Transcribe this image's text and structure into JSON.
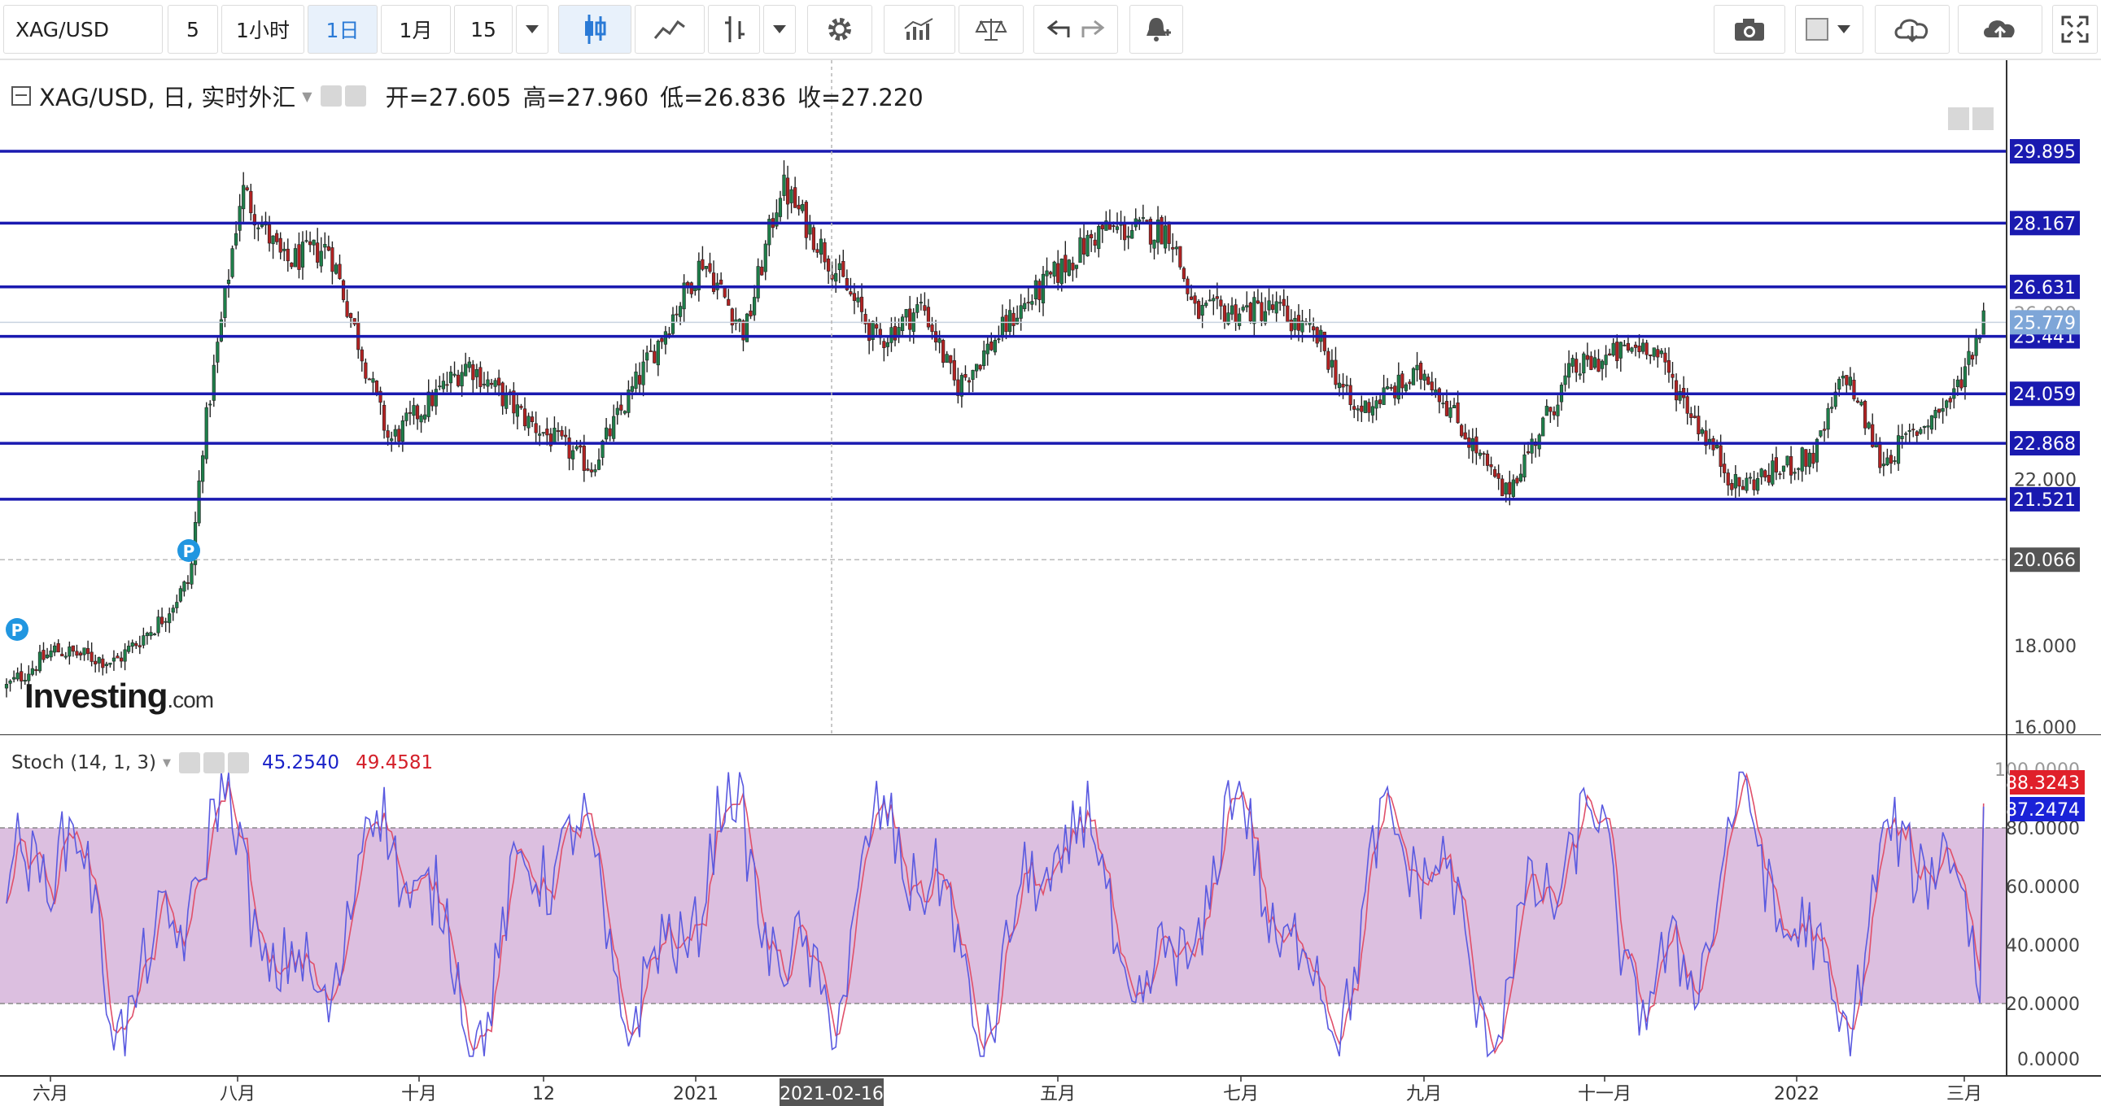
{
  "toolbar": {
    "symbol": "XAG/USD",
    "intervals": [
      "5",
      "1小时",
      "1日",
      "1月",
      "15"
    ],
    "active_interval": "1日"
  },
  "legend": {
    "title": "XAG/USD, 日, 实时外汇",
    "open": "开=27.605",
    "high": "高=27.960",
    "low": "低=26.836",
    "close": "收=27.220"
  },
  "stoch_legend": {
    "title": "Stoch (14, 1, 3)",
    "k_value": "45.2540",
    "d_value": "49.4581",
    "k_color": "#1a22c8",
    "d_color": "#d4202a"
  },
  "logo": {
    "text": "Investing",
    "suffix": ".com"
  },
  "colors": {
    "up": "#1e7f4a",
    "down": "#b22222",
    "hline": "#1a1ab0",
    "stoch_band": "#dcbfe0"
  },
  "price_axis": {
    "ticks": [
      "22.000",
      "20.066",
      "18.000",
      "16.000"
    ],
    "hline_labels": [
      "29.895",
      "28.167",
      "26.631",
      "25.441",
      "24.059",
      "22.868",
      "21.521"
    ],
    "current_label": "25.779",
    "partial_label": "26.000"
  },
  "stoch_axis": {
    "ticks": [
      "80.0000",
      "60.0000",
      "40.0000",
      "20.0000",
      "0.0000"
    ],
    "partial_top": "100.0000",
    "k_label": "88.3243",
    "d_label": "87.2474"
  },
  "xaxis": {
    "labels": [
      "六月",
      "八月",
      "十月",
      "12",
      "2021",
      "五月",
      "七月",
      "九月",
      "十一月",
      "2022",
      "三月"
    ],
    "cursor_label": "2021-02-16"
  },
  "chart_data": {
    "type": "candlestick",
    "title": "XAG/USD, 日, 实时外汇",
    "y_range": [
      16.0,
      30.6
    ],
    "horizontal_levels": [
      29.895,
      28.167,
      26.631,
      25.441,
      24.059,
      22.868,
      21.521
    ],
    "dashed_level": 20.066,
    "current_price": 25.779,
    "close_path": [
      {
        "d": "2020-05-20",
        "c": 17.0
      },
      {
        "d": "2020-06-05",
        "c": 17.9
      },
      {
        "d": "2020-06-25",
        "c": 17.6
      },
      {
        "d": "2020-07-10",
        "c": 18.6
      },
      {
        "d": "2020-07-20",
        "c": 19.6
      },
      {
        "d": "2020-07-24",
        "c": 22.8
      },
      {
        "d": "2020-08-06",
        "c": 29.0
      },
      {
        "d": "2020-08-20",
        "c": 27.2
      },
      {
        "d": "2020-09-04",
        "c": 27.6
      },
      {
        "d": "2020-09-24",
        "c": 22.9
      },
      {
        "d": "2020-10-20",
        "c": 24.8
      },
      {
        "d": "2020-11-09",
        "c": 23.4
      },
      {
        "d": "2020-11-30",
        "c": 22.3
      },
      {
        "d": "2021-01-06",
        "c": 27.3
      },
      {
        "d": "2021-01-20",
        "c": 25.5
      },
      {
        "d": "2021-02-01",
        "c": 29.1
      },
      {
        "d": "2021-02-16",
        "c": 27.4
      },
      {
        "d": "2021-03-05",
        "c": 25.3
      },
      {
        "d": "2021-03-20",
        "c": 26.2
      },
      {
        "d": "2021-03-31",
        "c": 24.2
      },
      {
        "d": "2021-04-20",
        "c": 26.0
      },
      {
        "d": "2021-05-18",
        "c": 28.0
      },
      {
        "d": "2021-06-10",
        "c": 28.0
      },
      {
        "d": "2021-06-18",
        "c": 26.0
      },
      {
        "d": "2021-07-15",
        "c": 26.1
      },
      {
        "d": "2021-07-30",
        "c": 25.3
      },
      {
        "d": "2021-08-10",
        "c": 23.6
      },
      {
        "d": "2021-09-03",
        "c": 24.6
      },
      {
        "d": "2021-09-29",
        "c": 21.6
      },
      {
        "d": "2021-10-21",
        "c": 24.6
      },
      {
        "d": "2021-11-16",
        "c": 25.3
      },
      {
        "d": "2021-12-15",
        "c": 21.8
      },
      {
        "d": "2022-01-10",
        "c": 22.6
      },
      {
        "d": "2022-01-20",
        "c": 24.6
      },
      {
        "d": "2022-02-01",
        "c": 22.4
      },
      {
        "d": "2022-02-25",
        "c": 24.0
      },
      {
        "d": "2022-03-07",
        "c": 25.9
      }
    ],
    "stochastic": {
      "name": "Stoch (14, 1, 3)",
      "overbought": 80,
      "oversold": 20,
      "last_k": 88.3243,
      "last_d": 87.2474
    }
  }
}
